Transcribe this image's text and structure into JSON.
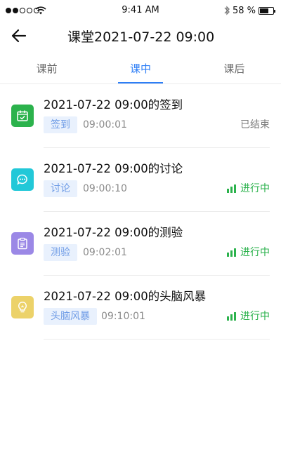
{
  "status_bar": {
    "time": "9:41 AM",
    "battery_percent": "58 %",
    "battery_level": 0.58,
    "signal_bars": 2,
    "icons": [
      "signal-dots-icon",
      "wifi-icon",
      "bluetooth-icon",
      "battery-icon"
    ]
  },
  "nav": {
    "back_icon": "arrow-left-icon",
    "title": "课堂2021-07-22 09:00"
  },
  "tabs": [
    {
      "label": "课前",
      "active": false
    },
    {
      "label": "课中",
      "active": true
    },
    {
      "label": "课后",
      "active": false
    }
  ],
  "colors": {
    "accent": "#2d7ef6",
    "tag_bg": "#e9f1fd",
    "tag_text": "#6f9ce6",
    "live_green": "#2bb24c",
    "divider": "#ececec"
  },
  "items": [
    {
      "title": "2021-07-22 09:00的签到",
      "tag": "签到",
      "time": "09:00:01",
      "status": "已结束",
      "status_type": "ended",
      "icon": "calendar-check-icon",
      "icon_color": "#2bb24c"
    },
    {
      "title": "2021-07-22 09:00的讨论",
      "tag": "讨论",
      "time": "09:00:10",
      "status": "进行中",
      "status_type": "live",
      "icon": "chat-bubble-icon",
      "icon_color": "#22c8d8"
    },
    {
      "title": "2021-07-22 09:00的测验",
      "tag": "测验",
      "time": "09:02:01",
      "status": "进行中",
      "status_type": "live",
      "icon": "clipboard-icon",
      "icon_color": "#9b88e6"
    },
    {
      "title": "2021-07-22 09:00的头脑风暴",
      "tag": "头脑风暴",
      "time": "09:10:01",
      "status": "进行中",
      "status_type": "live",
      "icon": "lightbulb-icon",
      "icon_color": "#ecd269"
    }
  ]
}
